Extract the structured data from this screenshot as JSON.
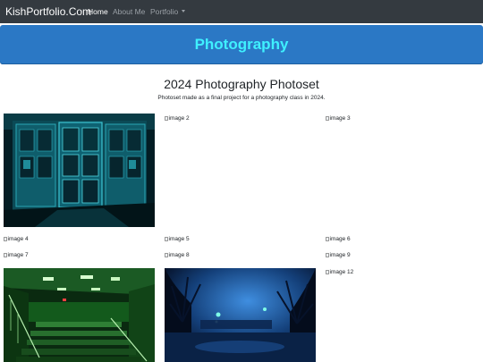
{
  "nav": {
    "brand": "KishPortfolio.Com",
    "links": [
      "Home",
      "About Me",
      "Portfolio"
    ]
  },
  "hero": {
    "title": "Photography"
  },
  "section": {
    "title": "2024 Photography Photoset",
    "description": "Photoset made as a final project for a photography class in 2024."
  },
  "gallery": {
    "broken_alts": [
      "image 2",
      "image 3",
      "image 4",
      "image 5",
      "image 6",
      "image 7",
      "image 8",
      "image 9",
      "image 12"
    ]
  },
  "colors": {
    "navbar": "#343a40",
    "hero_bg": "#2b78c5",
    "hero_text": "#3ff0ff"
  }
}
